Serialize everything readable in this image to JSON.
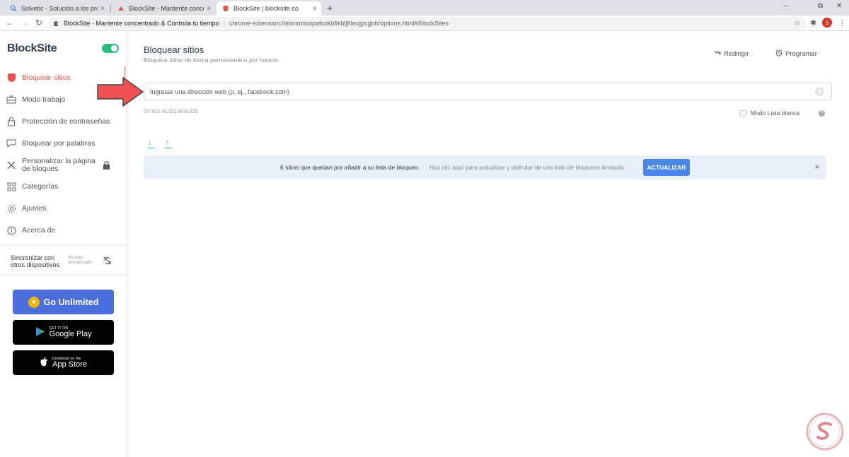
{
  "browser": {
    "tabs": [
      {
        "title": "Solvetic - Solución a los problem",
        "close": "×",
        "favicon": "search-favicon"
      },
      {
        "title": "BlockSite - Mantente concentrad",
        "close": "×",
        "favicon": "blocksite-favicon"
      },
      {
        "title": "BlockSite | blocksite.co",
        "close": "×",
        "favicon": "blocksite-shield-favicon"
      }
    ],
    "new_tab": "+",
    "window_controls": [
      "–",
      "⧉",
      "✕"
    ],
    "back": "←",
    "forward": "→",
    "reload": "↻",
    "omnibox": {
      "site_name": "BlockSite - Mantente concentrado & Controla tu tiempo",
      "url": "chrome-extension://eiimnmioipafcokbfikbljfdeojpcgbh/options.html#/blockSites",
      "separator": "|"
    },
    "star": "☆",
    "extensions": "✱",
    "profile_initial": "S",
    "menu": "⋮"
  },
  "sidebar": {
    "logo": "BlockSite",
    "enabled": true,
    "items": [
      {
        "label": "Bloquear sitios",
        "icon": "shield-icon",
        "active": true
      },
      {
        "label": "Modo trabajo",
        "icon": "briefcase-icon"
      },
      {
        "label": "Protección de contraseñas",
        "icon": "lock-outline-icon"
      },
      {
        "label": "Bloquear por palabras",
        "icon": "chat-icon"
      },
      {
        "label_line1": "Personalizar la página",
        "label_line2": "de bloques",
        "icon": "tools-icon"
      },
      {
        "label": "Categorías",
        "icon": "grid-icon"
      },
      {
        "label": "Ajustes",
        "icon": "gear-icon"
      },
      {
        "label": "Acerca de",
        "icon": "info-icon"
      }
    ],
    "sync": {
      "label_line1": "Sincronizar con",
      "label_line2": "otros dispositivos",
      "status_line1": "No está",
      "status_line2": "sincronizado"
    },
    "go_unlimited": "Go Unlimited",
    "google_play": {
      "small": "GET IT ON",
      "big": "Google Play"
    },
    "app_store": {
      "small": "Download on the",
      "big": "App Store"
    }
  },
  "main": {
    "title": "Bloquear sitios",
    "subtitle": "Bloquear sitios de forma permanente o por horario",
    "redirect_label": "Redirigir",
    "schedule_label": "Programar",
    "input_placeholder": "Ingresar una dirección web (p. ej., facebook.com)",
    "blocked_title": "SITIOS BLOQUEADOS",
    "whitelist_label": "Modo Lista blanca",
    "whitelist_checked": false,
    "help": "?",
    "banner": {
      "text": "6 sitios que quedan por añadir a su lista de bloqueo.",
      "hint": "Haz clic aquí para actualizar y disfrutar de una lista de bloqueos ilimitada.",
      "button": "ACTUALIZAR",
      "close": "×"
    }
  },
  "colors": {
    "accent_red": "#e5554f",
    "toggle_green": "#2bbd7e",
    "banner_bg": "#e8eff9",
    "button_blue": "#4a86e8",
    "go_unlimited_blue": "#4a6fdc"
  }
}
